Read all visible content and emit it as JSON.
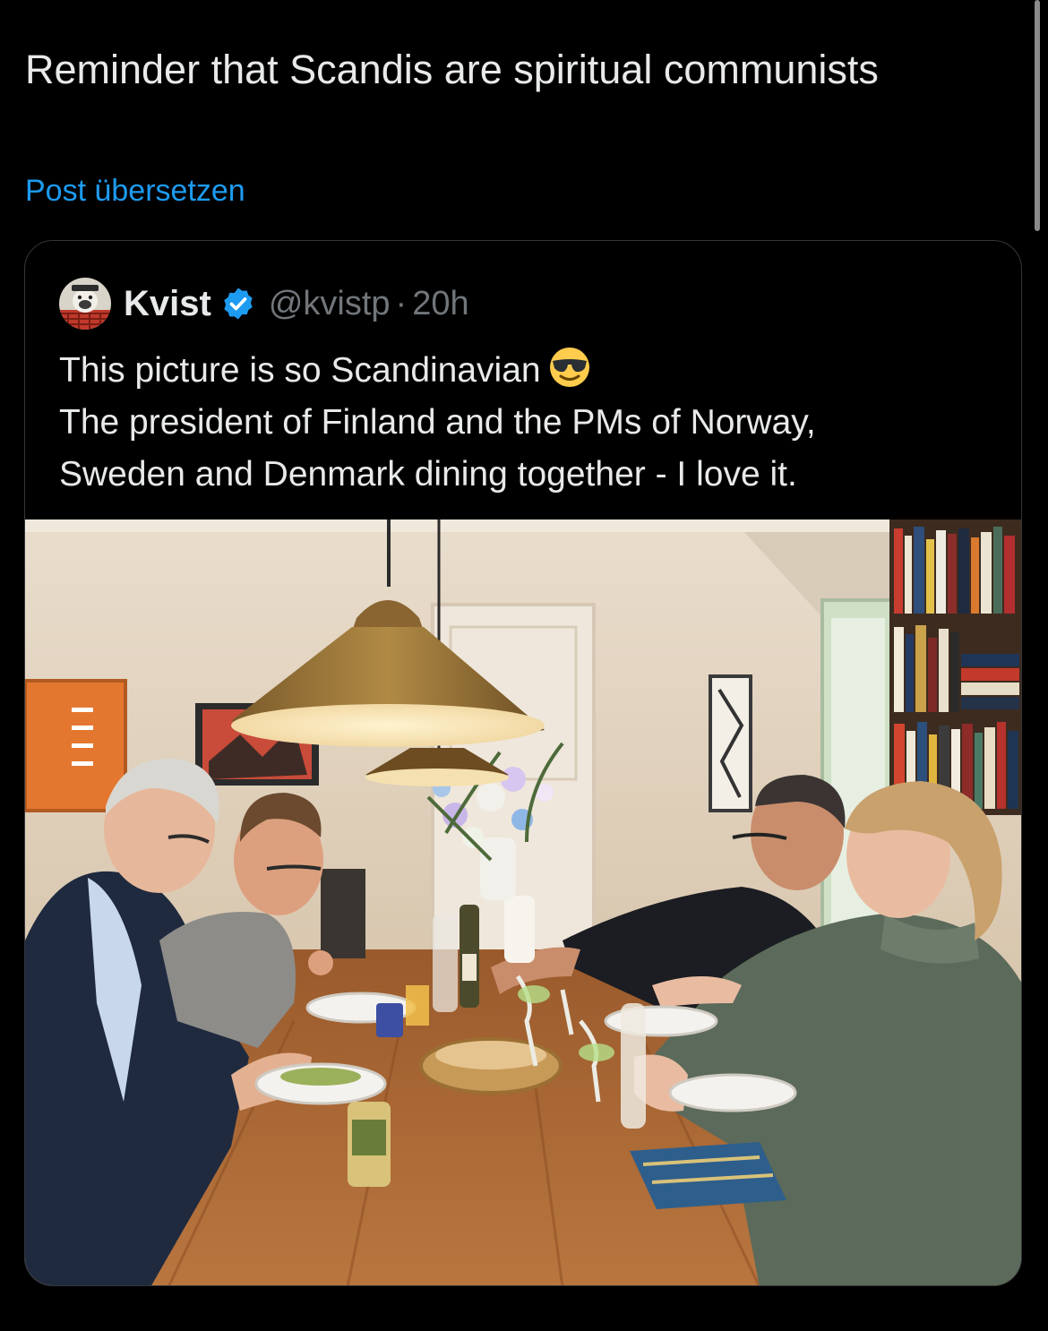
{
  "post": {
    "text": "Reminder that Scandis are spiritual communists",
    "translate_label": "Post übersetzen"
  },
  "quoted": {
    "author_name": "Kvist",
    "handle": "@kvistp",
    "separator": "·",
    "time": "20h",
    "verified": true,
    "lines": [
      "This picture is so Scandinavian",
      "The president of Finland and the PMs of Norway,",
      "Sweden and Denmark dining together - I love it."
    ],
    "emoji": "smiling-face-with-sunglasses"
  },
  "colors": {
    "background": "#000000",
    "text": "#e7e9ea",
    "secondary_text": "#71767b",
    "link": "#1d9bf0",
    "card_border": "#333639",
    "verified_badge": "#1d9bf0"
  }
}
